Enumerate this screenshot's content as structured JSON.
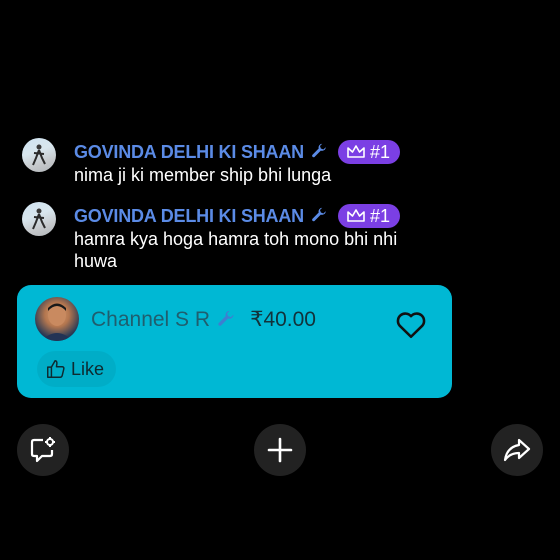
{
  "messages": [
    {
      "author": "GOVINDA DELHI KI SHAAN",
      "badge": "#1",
      "text": "nima ji ki member ship bhi lunga"
    },
    {
      "author": "GOVINDA DELHI KI SHAAN",
      "badge": "#1",
      "text": "hamra kya hoga hamra toh mono bhi nhi huwa"
    }
  ],
  "super_chat": {
    "author": "Channel S R",
    "amount": "₹40.00",
    "like_label": "Like",
    "color": "#00b8d4"
  },
  "icons": {
    "author_role": "wrench-icon",
    "membership": "crown-icon",
    "heart": "heart-icon",
    "like": "thumbs-up-icon",
    "chat_settings": "chat-settings-icon",
    "add": "plus-icon",
    "share": "share-icon"
  },
  "colors": {
    "author_name": "#5b8be6",
    "member_badge": "#7b3fe4",
    "background": "#000000"
  }
}
